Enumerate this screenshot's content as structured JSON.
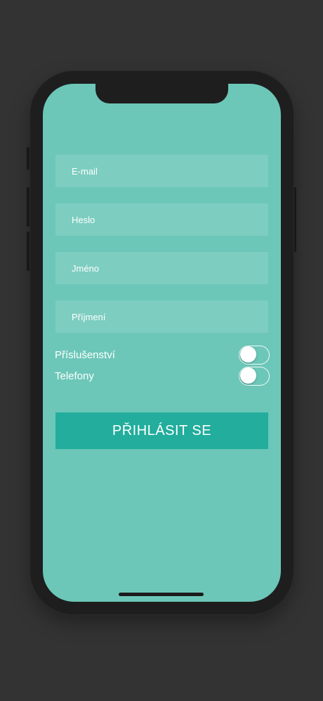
{
  "colors": {
    "background": "#333333",
    "screen": "#6cc7b8",
    "button": "#22ad9c",
    "text": "#ffffff"
  },
  "form": {
    "email_placeholder": "E-mail",
    "password_placeholder": "Heslo",
    "first_name_placeholder": "Jméno",
    "last_name_placeholder": "Příjmení"
  },
  "toggles": {
    "accessories_label": "Příslušenství",
    "accessories_on": false,
    "phones_label": "Telefony",
    "phones_on": false
  },
  "login_button_label": "PŘIHLÁSIT SE"
}
